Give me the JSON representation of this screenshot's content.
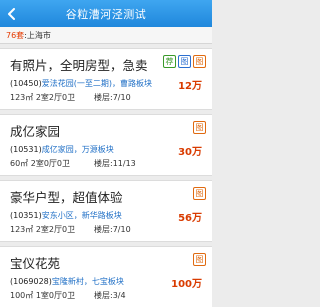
{
  "header": {
    "title": "谷粒漕河泾测试",
    "back_icon": "chevron-left-icon"
  },
  "subbar": {
    "count": "76套",
    "location": "上海市"
  },
  "listings": [
    {
      "name": "有照片，全明房型，急卖",
      "code": "(10450)",
      "location": "爱法花园(一至二期)，曹路板块",
      "area": "123㎡",
      "layout": "2室2厅0卫",
      "floor": "楼层:7/10",
      "price": "12万",
      "tags": [
        {
          "label": "荐",
          "color": "green"
        },
        {
          "label": "图",
          "color": "blue"
        },
        {
          "label": "图",
          "color": "orange"
        }
      ]
    },
    {
      "name": "成亿家园",
      "code": "(10531)",
      "location": "成亿家园，万源板块",
      "area": "60㎡",
      "layout": "2室0厅0卫",
      "floor": "楼层:11/13",
      "price": "30万",
      "tags": [
        {
          "label": "图",
          "color": "orange"
        }
      ]
    },
    {
      "name": "豪华户型，超值体验",
      "code": "(10351)",
      "location": "安东小区，新华路板块",
      "area": "123㎡",
      "layout": "2室2厅0卫",
      "floor": "楼层:7/10",
      "price": "56万",
      "tags": [
        {
          "label": "图",
          "color": "orange"
        }
      ]
    },
    {
      "name": "宝仪花苑",
      "code": "(1069028)",
      "location": "宝隆新村，七宝板块",
      "area": "100㎡",
      "layout": "1室0厅0卫",
      "floor": "楼层:3/4",
      "price": "100万",
      "tags": [
        {
          "label": "图",
          "color": "orange"
        }
      ]
    }
  ]
}
